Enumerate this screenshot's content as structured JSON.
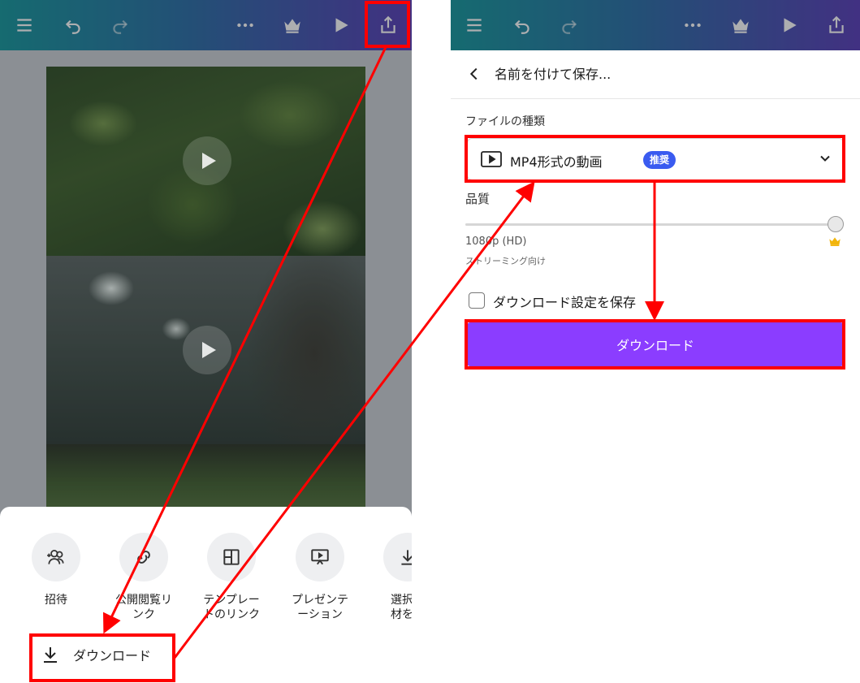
{
  "colors": {
    "accent_purple": "#8b3dff",
    "badge_blue": "#3a5bf0",
    "annotation_red": "#ff0000",
    "topbar_start": "#17989d",
    "topbar_end": "#5a3fb8"
  },
  "left": {
    "toolbar_icons": [
      "menu-icon",
      "undo-icon",
      "redo-icon",
      "more-icon",
      "crown-icon",
      "play-icon",
      "share-icon"
    ],
    "share_sheet": {
      "items": [
        {
          "label": "招待",
          "icon": "invite-icon"
        },
        {
          "label": "公開閲覧リ\nンク",
          "icon": "link-icon"
        },
        {
          "label": "テンプレー\nトのリンク",
          "icon": "template-icon"
        },
        {
          "label": "プレゼンテ\nーション",
          "icon": "present-icon"
        },
        {
          "label": "選択し\n材をダ",
          "icon": "download-selected-icon"
        }
      ],
      "download_label": "ダウンロード"
    }
  },
  "right": {
    "toolbar_icons": [
      "menu-icon",
      "undo-icon",
      "redo-icon",
      "more-icon",
      "crown-icon",
      "play-icon",
      "share-icon"
    ],
    "header_title": "名前を付けて保存...",
    "file_type_label": "ファイルの種類",
    "file_type_value": "MP4形式の動画",
    "recommended_badge": "推奨",
    "quality_label": "品質",
    "quality_level": 1.0,
    "quality_value": "1080p (HD)",
    "quality_note": "ストリーミング向け",
    "save_settings_label": "ダウンロード設定を保存",
    "save_settings_checked": false,
    "download_button": "ダウンロード"
  }
}
